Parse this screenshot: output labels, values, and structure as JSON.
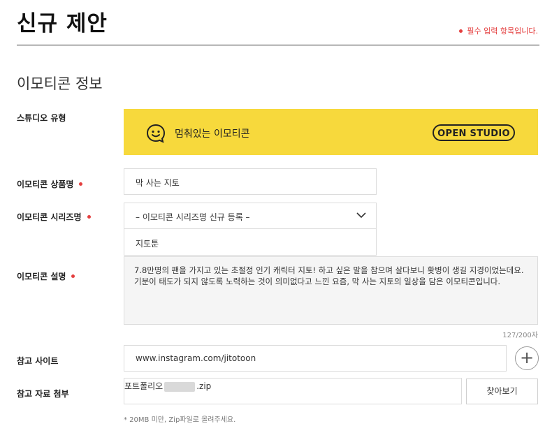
{
  "page": {
    "title": "신규 제안",
    "required_note": "필수 입력 항목입니다.",
    "accent_color": "#e43f3f"
  },
  "section": {
    "title": "이모티콘 정보"
  },
  "studio_type": {
    "label": "스튜디오 유형",
    "banner_text": "멈춰있는 이모티콘",
    "badge": "OPEN STUDIO",
    "banner_color": "#f7d93c",
    "icon": "smile-icon"
  },
  "product_name": {
    "label": "이모티콘 상품명",
    "value": "막 사는 지토"
  },
  "series_name": {
    "label": "이모티콘 시리즈명",
    "selected": "– 이모티콘 시리즈명 신규 등록 –",
    "new_value": "지토툰"
  },
  "description": {
    "label": "이모티콘 설명",
    "value": "7.8만명의 팬을 가지고 있는 초절정 인기 캐릭터 지토! 하고 싶은 말을 참으며 살다보니 홧병이 생길 지경이었는데요. 기분이 태도가 되지 않도록 노력하는 것이 의미없다고 느낀 요즘, 막 사는 지토의 일상을 담은 이모티콘입니다.",
    "counter": "127/200자"
  },
  "reference_site": {
    "label": "참고 사이트",
    "value": "www.instagram.com/jitotoon"
  },
  "attachment": {
    "label": "참고 자료 첨부",
    "file_prefix": "포트폴리오",
    "file_suffix": ".zip",
    "browse_label": "찾아보기",
    "help": "* 20MB 미만, Zip파일로 올려주세요."
  }
}
